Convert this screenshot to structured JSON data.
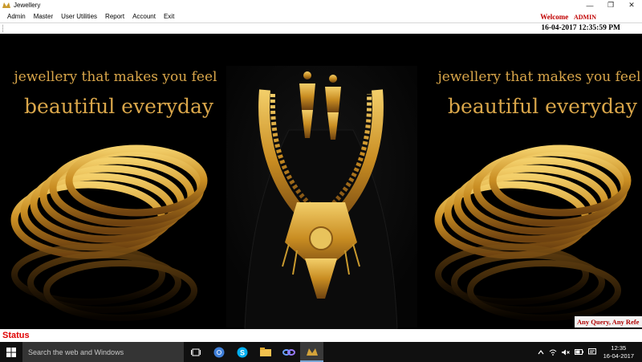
{
  "window": {
    "title": "Jewellery"
  },
  "window_controls": {
    "minimize": "—",
    "maximize": "❐",
    "close": "✕"
  },
  "menu": [
    "Admin",
    "Master",
    "User Utilities",
    "Report",
    "Account",
    "Exit"
  ],
  "welcome": {
    "label": "Welcome",
    "user": "ADMIN"
  },
  "datetime": "16-04-2017 12:35:59 PM",
  "banner": {
    "left_line1": "jewellery that makes you feel",
    "left_line2": "beautiful everyday",
    "right_line1": "jewellery that makes you feel",
    "right_line2": "beautiful everyday"
  },
  "query_text": "Any Query, Any Refe",
  "status": {
    "label": "Status"
  },
  "taskbar": {
    "search_placeholder": "Search the web and Windows",
    "icons": [
      "task-view-icon",
      "chrome-icon",
      "skype-icon",
      "file-explorer-icon",
      "app-icon",
      "jewellery-app-icon"
    ],
    "time": "12:35",
    "date": "16-04-2017"
  },
  "colors": {
    "accent_red": "#c00000",
    "gold": "#d9a64a",
    "taskbar": "#101010"
  }
}
